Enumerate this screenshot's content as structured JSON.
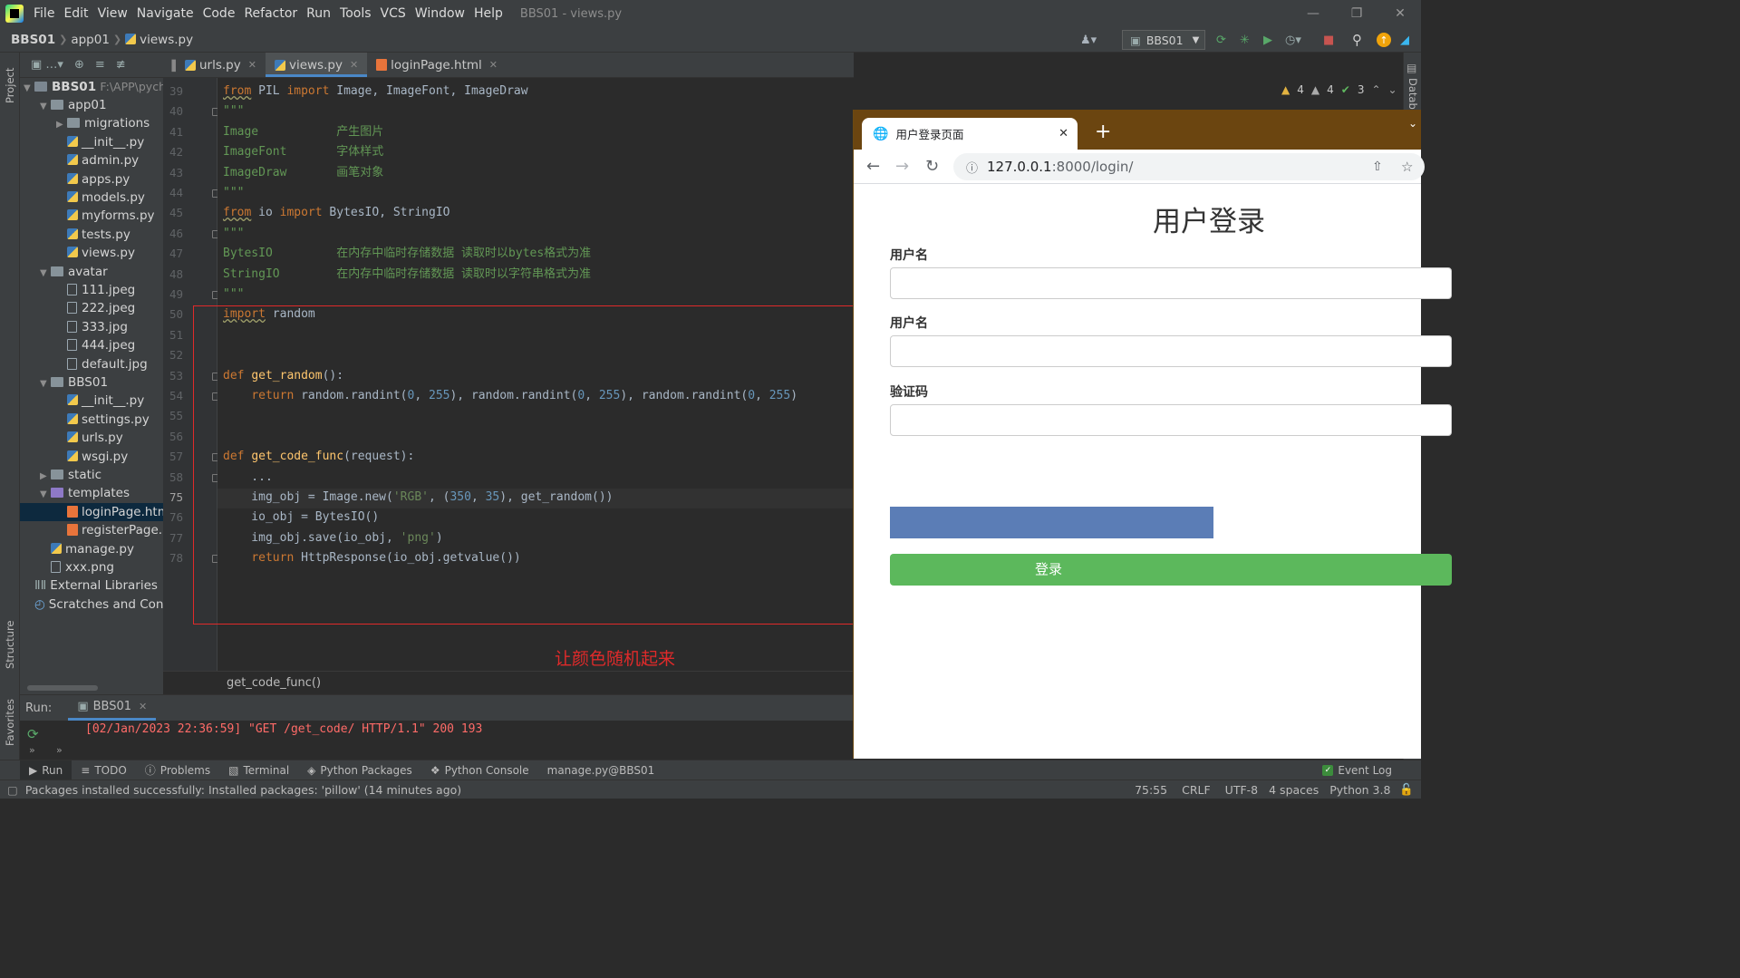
{
  "menubar": {
    "items": [
      "File",
      "Edit",
      "View",
      "Navigate",
      "Code",
      "Refactor",
      "Run",
      "Tools",
      "VCS",
      "Window",
      "Help"
    ],
    "window_title": "BBS01 - views.py"
  },
  "breadcrumb": {
    "project": "BBS01",
    "folder": "app01",
    "file": "views.py"
  },
  "run_config": "BBS01",
  "project_panel": {
    "root": "BBS01",
    "root_path": "F:\\APP\\pychar",
    "tree": [
      {
        "label": "app01",
        "kind": "folder",
        "depth": 1,
        "open": true
      },
      {
        "label": "migrations",
        "kind": "folder",
        "depth": 2,
        "open": false
      },
      {
        "label": "__init__.py",
        "kind": "py",
        "depth": 2
      },
      {
        "label": "admin.py",
        "kind": "py",
        "depth": 2
      },
      {
        "label": "apps.py",
        "kind": "py",
        "depth": 2
      },
      {
        "label": "models.py",
        "kind": "py",
        "depth": 2
      },
      {
        "label": "myforms.py",
        "kind": "py",
        "depth": 2
      },
      {
        "label": "tests.py",
        "kind": "py",
        "depth": 2
      },
      {
        "label": "views.py",
        "kind": "py",
        "depth": 2
      },
      {
        "label": "avatar",
        "kind": "folder",
        "depth": 1,
        "open": true
      },
      {
        "label": "111.jpeg",
        "kind": "file",
        "depth": 2
      },
      {
        "label": "222.jpeg",
        "kind": "file",
        "depth": 2
      },
      {
        "label": "333.jpg",
        "kind": "file",
        "depth": 2
      },
      {
        "label": "444.jpeg",
        "kind": "file",
        "depth": 2
      },
      {
        "label": "default.jpg",
        "kind": "file",
        "depth": 2
      },
      {
        "label": "BBS01",
        "kind": "folder",
        "depth": 1,
        "open": true
      },
      {
        "label": "__init__.py",
        "kind": "py",
        "depth": 2
      },
      {
        "label": "settings.py",
        "kind": "py",
        "depth": 2
      },
      {
        "label": "urls.py",
        "kind": "py",
        "depth": 2
      },
      {
        "label": "wsgi.py",
        "kind": "py",
        "depth": 2
      },
      {
        "label": "static",
        "kind": "folder",
        "depth": 1,
        "open": false
      },
      {
        "label": "templates",
        "kind": "folder-purple",
        "depth": 1,
        "open": true
      },
      {
        "label": "loginPage.html",
        "kind": "html",
        "depth": 2,
        "selected": true
      },
      {
        "label": "registerPage.html",
        "kind": "html",
        "depth": 2
      },
      {
        "label": "manage.py",
        "kind": "py",
        "depth": 1
      },
      {
        "label": "xxx.png",
        "kind": "file",
        "depth": 1
      },
      {
        "label": "External Libraries",
        "kind": "lib",
        "depth": 0
      },
      {
        "label": "Scratches and Consoles",
        "kind": "scratch",
        "depth": 0
      }
    ]
  },
  "tabs": [
    {
      "label": "urls.py",
      "active": false
    },
    {
      "label": "views.py",
      "active": true
    },
    {
      "label": "loginPage.html",
      "active": false
    }
  ],
  "inspections": {
    "warn1": "4",
    "warn2": "4",
    "ok": "3"
  },
  "code_lines": [
    {
      "n": "39",
      "html": "from PIL import Image, ImageFont, ImageDraw"
    },
    {
      "n": "40",
      "html": "\"\"\""
    },
    {
      "n": "41",
      "html": "Image           产生图片"
    },
    {
      "n": "42",
      "html": "ImageFont       字体样式"
    },
    {
      "n": "43",
      "html": "ImageDraw       画笔对象"
    },
    {
      "n": "44",
      "html": "\"\"\""
    },
    {
      "n": "45",
      "html": "from io import BytesIO, StringIO"
    },
    {
      "n": "46",
      "html": "\"\"\""
    },
    {
      "n": "47",
      "html": "BytesIO         在内存中临时存储数据 读取时以bytes格式为准"
    },
    {
      "n": "48",
      "html": "StringIO        在内存中临时存储数据 读取时以字符串格式为准"
    },
    {
      "n": "49",
      "html": "\"\"\""
    },
    {
      "n": "50",
      "html": "import random"
    },
    {
      "n": "51",
      "html": ""
    },
    {
      "n": "52",
      "html": ""
    },
    {
      "n": "53",
      "html": "def get_random():"
    },
    {
      "n": "54",
      "html": "    return random.randint(0, 255), random.randint(0, 255), random.randint(0, 255)"
    },
    {
      "n": "55",
      "html": ""
    },
    {
      "n": "56",
      "html": ""
    },
    {
      "n": "57",
      "html": "def get_code_func(request):"
    },
    {
      "n": "58",
      "html": "    ..."
    },
    {
      "n": "75",
      "html": "    img_obj = Image.new('RGB', (350, 35), get_random())"
    },
    {
      "n": "76",
      "html": "    io_obj = BytesIO()"
    },
    {
      "n": "77",
      "html": "    img_obj.save(io_obj, 'png')"
    },
    {
      "n": "78",
      "html": "    return HttpResponse(io_obj.getvalue())"
    }
  ],
  "annotation": "让颜色随机起来",
  "code_breadcrumb": "get_code_func()",
  "run_panel": {
    "label": "Run:",
    "tab": "BBS01",
    "output": "[02/Jan/2023 22:36:59] \"GET /get_code/ HTTP/1.1\" 200 193"
  },
  "bottom_tabs": [
    "Run",
    "TODO",
    "Problems",
    "Terminal",
    "Python Packages",
    "Python Console",
    "manage.py@BBS01"
  ],
  "event_log": "Event Log",
  "status": {
    "message": "Packages installed successfully: Installed packages: 'pillow' (14 minutes ago)",
    "position": "75:55",
    "line_sep": "CRLF",
    "encoding": "UTF-8",
    "indent": "4 spaces",
    "interpreter": "Python 3.8"
  },
  "side_labels": {
    "project": "Project",
    "structure": "Structure",
    "favorites": "Favorites",
    "database": "Database"
  },
  "browser": {
    "tab_title": "用户登录页面",
    "url_host": "127.0.0.1",
    "url_rest": ":8000/login/",
    "page_title": "用户登录",
    "label1": "用户名",
    "label2": "用户名",
    "label3": "验证码",
    "login_button": "登录"
  },
  "colors": {
    "accent": "#4a88c7",
    "annotation_red": "#e02a2a",
    "login_green": "#5cb85c",
    "captcha_blue": "#5b7db6"
  }
}
